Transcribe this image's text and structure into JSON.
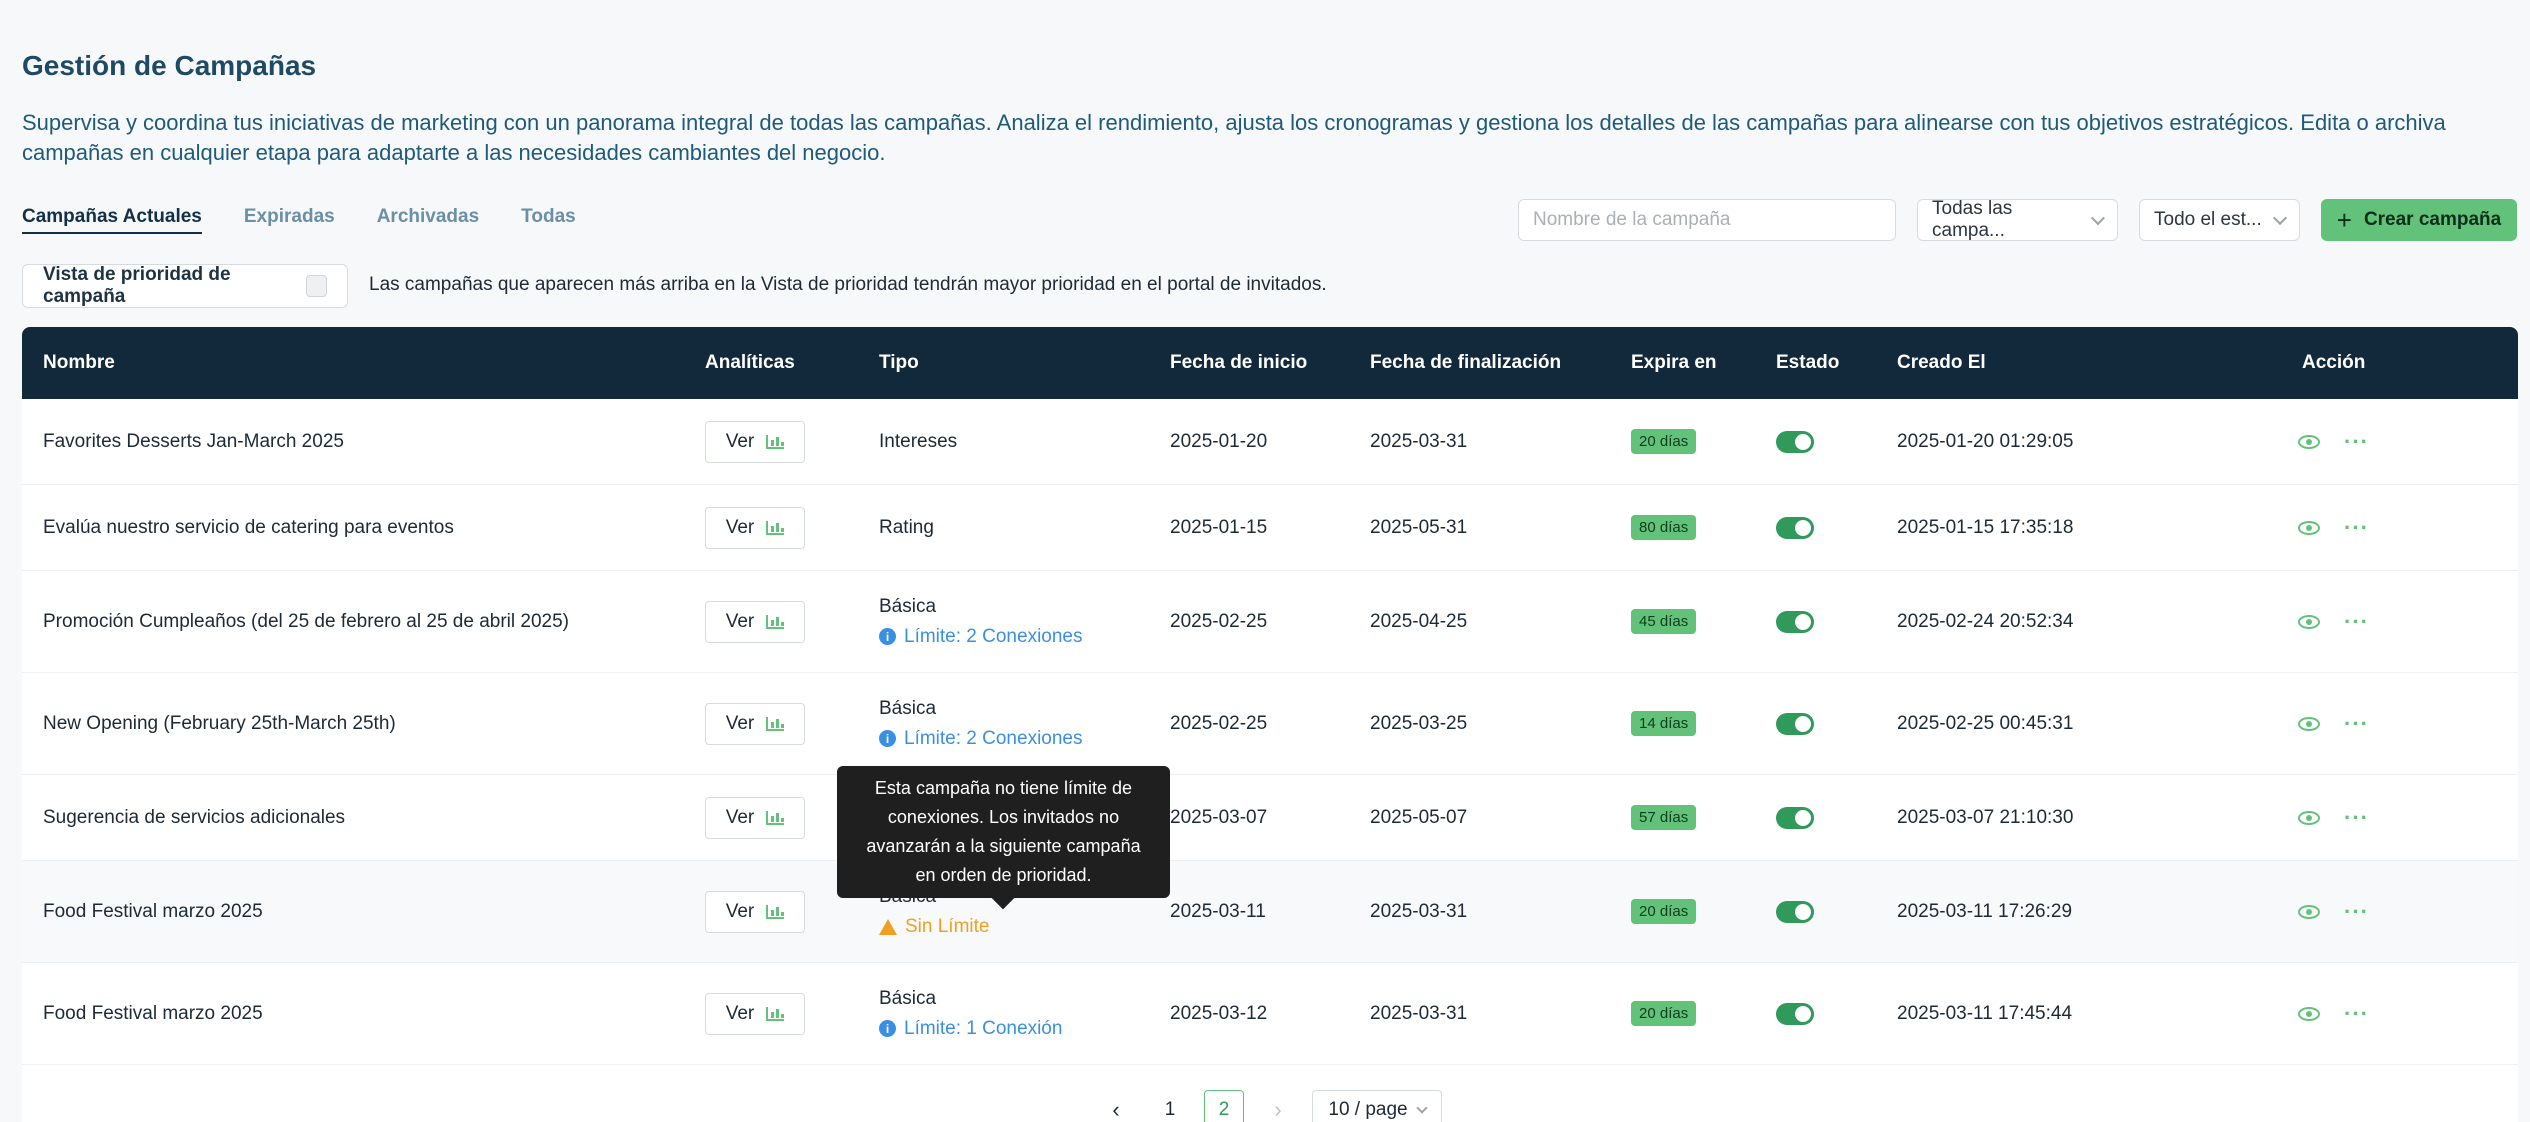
{
  "page": {
    "title": "Gestión de Campañas",
    "description": "Supervisa y coordina tus iniciativas de marketing con un panorama integral de todas las campañas. Analiza el rendimiento, ajusta los cronogramas y gestiona los detalles de las campañas para alinearse con tus objetivos estratégicos. Edita o archiva campañas en cualquier etapa para adaptarte a las necesidades cambiantes del negocio."
  },
  "tabs": [
    {
      "label": "Campañas Actuales",
      "active": true
    },
    {
      "label": "Expiradas"
    },
    {
      "label": "Archivadas"
    },
    {
      "label": "Todas"
    }
  ],
  "toolbar": {
    "search_placeholder": "Nombre de la campaña",
    "type_filter": "Todas las campa...",
    "status_filter": "Todo el est...",
    "create_label": "Crear campaña"
  },
  "priority": {
    "toggle_label": "Vista de prioridad de campaña",
    "note": "Las campañas que aparecen más arriba en la Vista de prioridad tendrán mayor prioridad en el portal de invitados."
  },
  "table": {
    "headers": [
      "Nombre",
      "Analíticas",
      "Tipo",
      "Fecha de inicio",
      "Fecha de finalización",
      "Expira en",
      "Estado",
      "Creado El",
      "Acción"
    ],
    "view_label": "Ver",
    "rows": [
      {
        "name": "Favorites Desserts Jan-March 2025",
        "type": "Intereses",
        "limit": "",
        "start": "2025-01-20",
        "end": "2025-03-31",
        "expires": "20 días",
        "created": "2025-01-20 01:29:05"
      },
      {
        "name": "Evalúa nuestro servicio de catering para eventos",
        "type": "Rating",
        "limit": "",
        "start": "2025-01-15",
        "end": "2025-05-31",
        "expires": "80 días",
        "created": "2025-01-15 17:35:18"
      },
      {
        "name": "Promoción Cumpleaños (del 25 de febrero al 25 de abril 2025)",
        "type": "Básica",
        "limit": "Límite: 2 Conexiones",
        "start": "2025-02-25",
        "end": "2025-04-25",
        "expires": "45 días",
        "created": "2025-02-24 20:52:34"
      },
      {
        "name": "New Opening (February 25th-March 25th)",
        "type": "Básica",
        "limit": "Límite: 2 Conexiones",
        "start": "2025-02-25",
        "end": "2025-03-25",
        "expires": "14 días",
        "created": "2025-02-25 00:45:31"
      },
      {
        "name": "Sugerencia de servicios adicionales",
        "type": "",
        "limit": "",
        "start": "2025-03-07",
        "end": "2025-05-07",
        "expires": "57 días",
        "created": "2025-03-07 21:10:30"
      },
      {
        "name": "Food Festival marzo 2025",
        "type": "Básica",
        "limit": "",
        "nolimit": "Sin Límite",
        "start": "2025-03-11",
        "end": "2025-03-31",
        "expires": "20 días",
        "created": "2025-03-11 17:26:29"
      },
      {
        "name": "Food Festival marzo 2025",
        "type": "Básica",
        "limit": "Límite: 1 Conexión",
        "start": "2025-03-12",
        "end": "2025-03-31",
        "expires": "20 días",
        "created": "2025-03-11 17:45:44"
      }
    ]
  },
  "tooltip": {
    "text": "Esta campaña no tiene límite de conexiones. Los invitados no avanzarán a la siguiente campaña en orden de prioridad."
  },
  "pagination": {
    "pages": [
      "1",
      "2"
    ],
    "current": "2",
    "page_size": "10 / page"
  },
  "colors": {
    "accent": "#62c27a",
    "header_bg": "#12293b",
    "info": "#3b8fe0",
    "warning": "#f0a020"
  }
}
